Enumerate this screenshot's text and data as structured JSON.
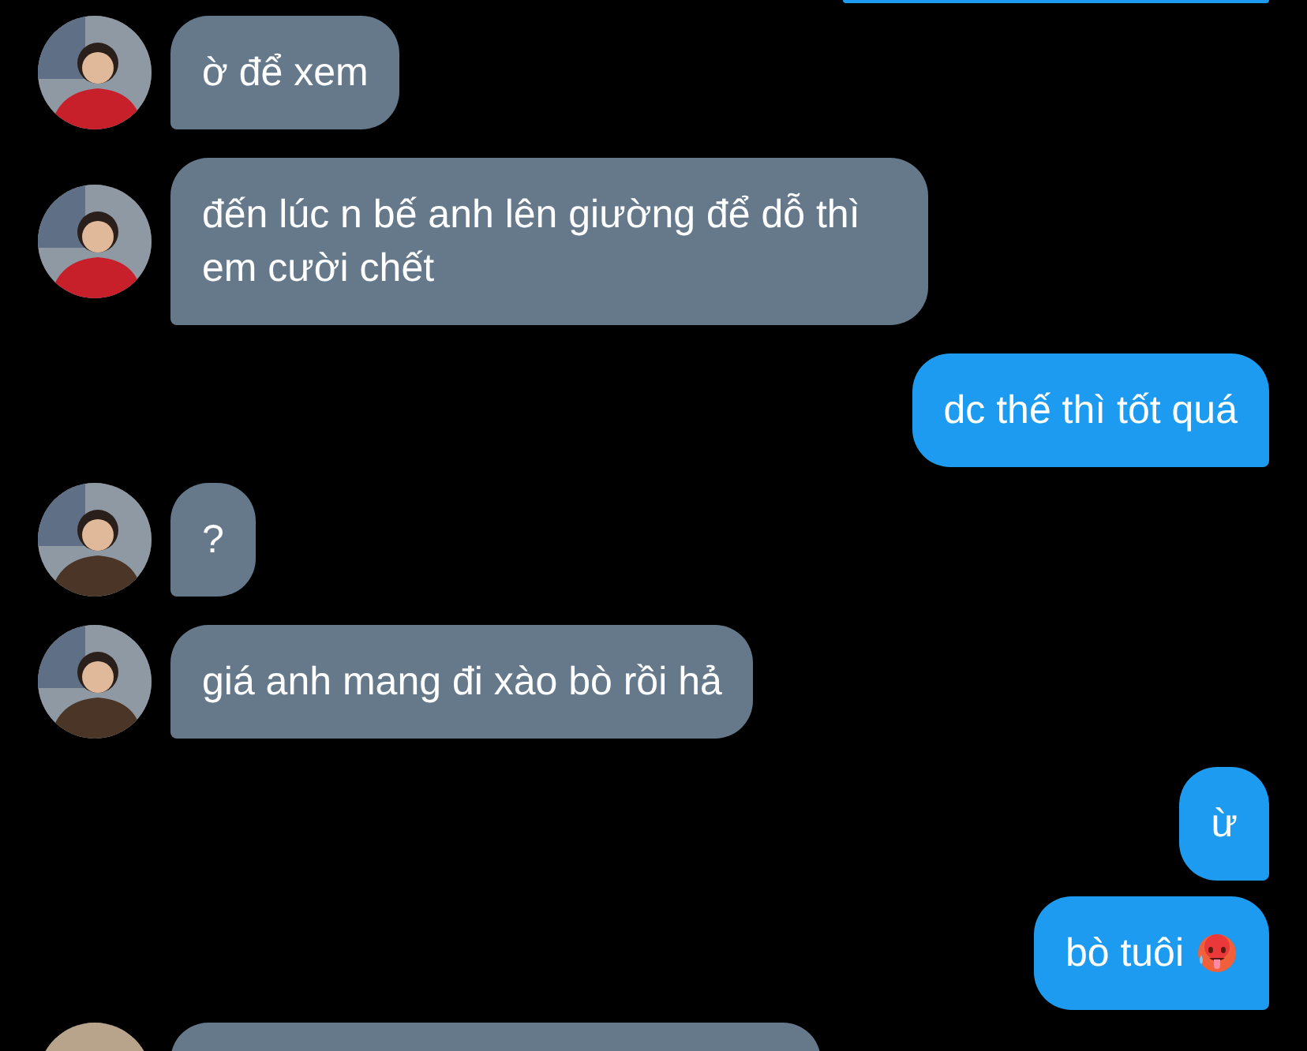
{
  "messages": [
    {
      "kind": "topstub"
    },
    {
      "kind": "incoming",
      "color": "#c8202a",
      "text": "ờ để xem"
    },
    {
      "kind": "incoming",
      "color": "#c8202a",
      "text": "đến lúc n bế anh lên giường để dỗ thì em cười chết"
    },
    {
      "kind": "outgoing",
      "text": "dc thế thì tốt quá"
    },
    {
      "kind": "incoming",
      "color": "#4a3526",
      "text": "?"
    },
    {
      "kind": "incoming",
      "color": "#4a3526",
      "text": "giá anh mang đi xào bò rồi hả"
    },
    {
      "kind": "outgoing",
      "text": "ừ"
    },
    {
      "kind": "outgoing",
      "text": "bò tuôi",
      "emoji": true
    },
    {
      "kind": "bottomstub",
      "color": "#b8a48a"
    }
  ]
}
